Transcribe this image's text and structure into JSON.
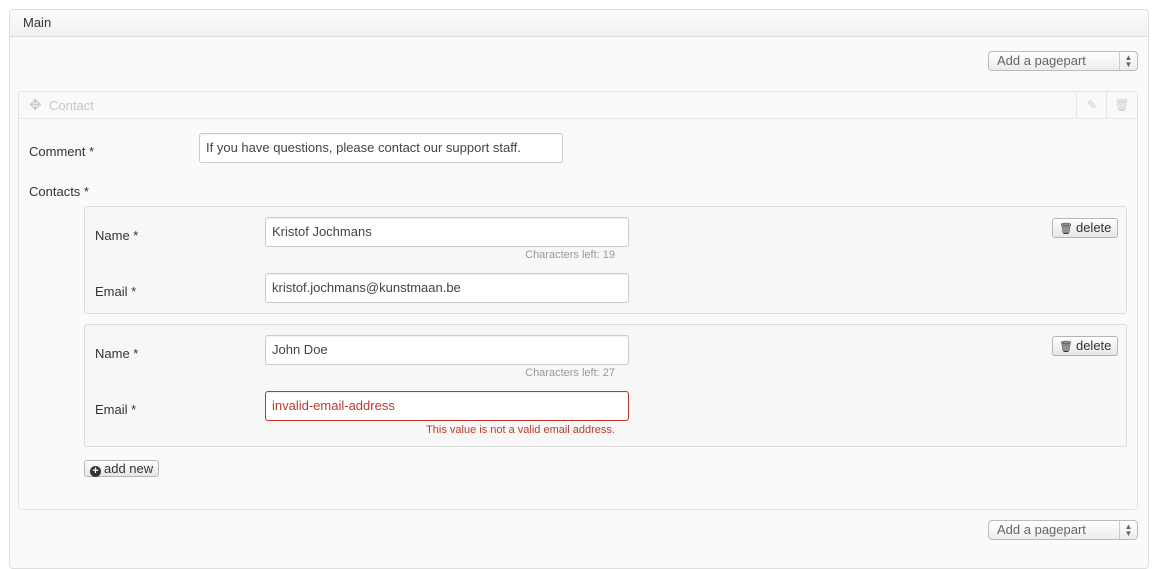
{
  "panel": {
    "title": "Main"
  },
  "pagepart_select": {
    "label": "Add a pagepart"
  },
  "contact": {
    "title": "Contact",
    "comment": {
      "label": "Comment *",
      "value": "If you have questions, please contact our support staff."
    },
    "contacts_label": "Contacts *",
    "items": [
      {
        "name_label": "Name *",
        "name_value": "Kristof Jochmans",
        "name_help": "Characters left: 19",
        "email_label": "Email *",
        "email_value": "kristof.jochmans@kunstmaan.be",
        "delete_label": "delete"
      },
      {
        "name_label": "Name *",
        "name_value": "John Doe",
        "name_help": "Characters left: 27",
        "email_label": "Email *",
        "email_value": "invalid-email-address",
        "email_error": "This value is not a valid email address.",
        "delete_label": "delete"
      }
    ],
    "add_new_label": "add new"
  },
  "icons": {
    "move": "move-icon",
    "edit": "edit-icon",
    "trash": "trash-icon",
    "plus": "plus-circle-icon",
    "select_arrows": "select-arrows-icon"
  },
  "colors": {
    "error": "#c0392b",
    "border": "#cccccc",
    "muted": "#999999"
  }
}
